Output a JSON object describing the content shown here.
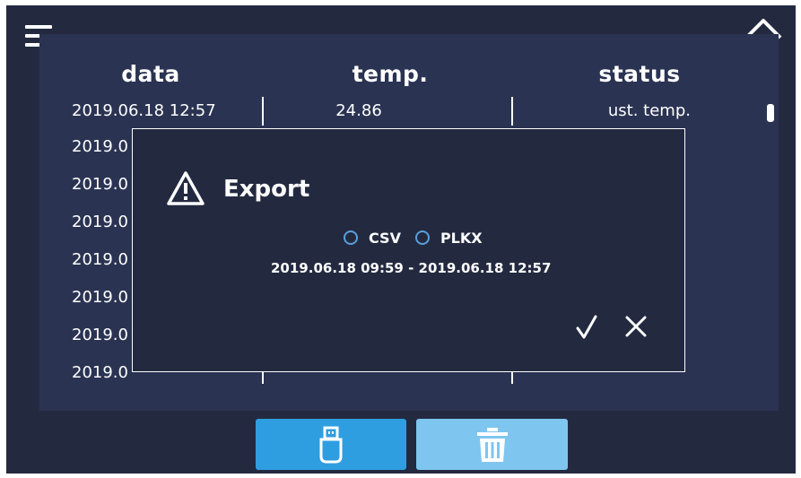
{
  "columns": {
    "date": "data",
    "temp": "temp.",
    "status": "status"
  },
  "rows": [
    {
      "date": "2019.06.18  12:57",
      "temp": "24.86",
      "status": "ust. temp."
    },
    {
      "date": "2019.0"
    },
    {
      "date": "2019.0"
    },
    {
      "date": "2019.0"
    },
    {
      "date": "2019.0"
    },
    {
      "date": "2019.0"
    },
    {
      "date": "2019.0"
    },
    {
      "date": "2019.0"
    }
  ],
  "dialog": {
    "title": "Export",
    "formats": [
      "CSV",
      "PLKX"
    ],
    "range": "2019.06.18  09:59 - 2019.06.18  12:57"
  },
  "icons": {
    "menu": "hamburger-icon",
    "home": "home-icon",
    "warning": "warning-icon",
    "confirm": "check-icon",
    "cancel": "close-icon",
    "export": "usb-drive-icon",
    "delete": "trash-icon"
  },
  "colors": {
    "background": "#232a40",
    "panel": "#2a3352",
    "radio": "#5aa0dc",
    "export_button": "#2f9ee0",
    "delete_button": "#7ec5f0"
  }
}
